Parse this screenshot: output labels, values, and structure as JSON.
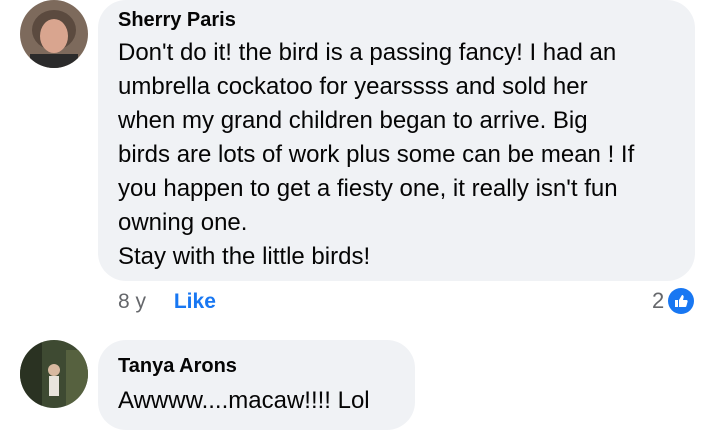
{
  "comments": [
    {
      "author": "Sherry Paris",
      "text": "Don't do it! the bird is a passing fancy! I had an\numbrella cockatoo for yearssss and sold her\nwhen my grand children began to arrive. Big\nbirds are lots of work plus some can be mean ! If\nyou happen to get a fiesty one, it really isn't fun\nowning one.\nStay with the little birds!",
      "time": "8 y",
      "like_label": "Like",
      "reaction_count": "2",
      "reaction_icon": "thumbs-up-icon"
    },
    {
      "author": "Tanya Arons",
      "text": "Awwww....macaw!!!!  Lol"
    }
  ],
  "colors": {
    "bubble": "#f0f2f5",
    "link": "#1877f2",
    "meta": "#65676b"
  }
}
